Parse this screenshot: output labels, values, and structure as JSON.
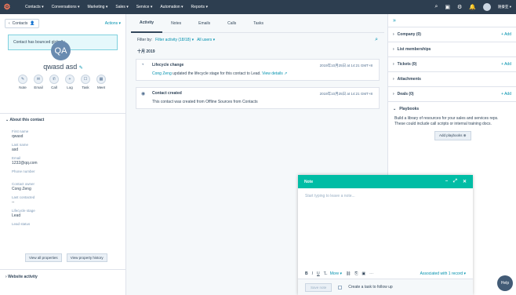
{
  "nav": {
    "logo": "⚙",
    "items": [
      "Contacts ▾",
      "Conversations ▾",
      "Marketing ▾",
      "Sales ▾",
      "Service ▾",
      "Automation ▾",
      "Reports ▾"
    ],
    "user": "随秦亚 ▾"
  },
  "left": {
    "contacts_btn": "Contacts",
    "actions": "Actions ▾",
    "bounce": "Contact has bounced globally.",
    "initials": "QA",
    "name": "qwasd asd",
    "quick": [
      "Note",
      "Email",
      "Call",
      "Log",
      "Task",
      "Meet"
    ],
    "about": "About this contact",
    "props": [
      {
        "label": "First name",
        "value": "qwasd"
      },
      {
        "label": "Last name",
        "value": "asd"
      },
      {
        "label": "Email",
        "value": "1232@qq.com"
      },
      {
        "label": "Phone number",
        "value": ""
      },
      {
        "label": "Contact owner",
        "value": "Cong Zeng"
      },
      {
        "label": "Last contacted",
        "value": "--"
      },
      {
        "label": "Lifecycle stage",
        "value": "Lead"
      },
      {
        "label": "Lead status",
        "value": ""
      }
    ],
    "view_all": "View all properties",
    "view_history": "View property history",
    "website": "Website activity"
  },
  "middle": {
    "tabs": [
      "Activity",
      "Notes",
      "Emails",
      "Calls",
      "Tasks"
    ],
    "filter_by": "Filter by:",
    "filter_activity": "Filter activity (18/18) ▾",
    "all_users": "All users ▾",
    "month": "十月 2019",
    "card1": {
      "title": "Lifecycle change",
      "time": "2019年10月25日 at 14:21 GMT+8",
      "actor": "Cong Zeng",
      "text": " updated the lifecycle stage for this contact to Lead. ",
      "link": "View details ↗"
    },
    "card2": {
      "title": "Contact created",
      "time": "2019年10月25日 at 14:21 GMT+8",
      "text": "This contact was created from Offline Sources from Contacts"
    }
  },
  "right": {
    "sections": [
      {
        "title": "Company (0)",
        "add": "+ Add"
      },
      {
        "title": "List memberships",
        "add": ""
      },
      {
        "title": "Tickets (0)",
        "add": "+ Add"
      },
      {
        "title": "Attachments",
        "add": ""
      },
      {
        "title": "Deals (0)",
        "add": "+ Add"
      }
    ],
    "playbooks": "Playbooks",
    "play_text": "Build a library of resources for your sales and services reps. These could include call scripts or internal training docs.",
    "add_playbooks": "Add playbooks ⊕"
  },
  "note": {
    "title": "Note",
    "placeholder": "Start typing to leave a note...",
    "more": "More ▾",
    "associated": "Associated with 1 record ▾",
    "save": "Save note",
    "followup": "Create a task to follow up"
  },
  "help": "Help"
}
